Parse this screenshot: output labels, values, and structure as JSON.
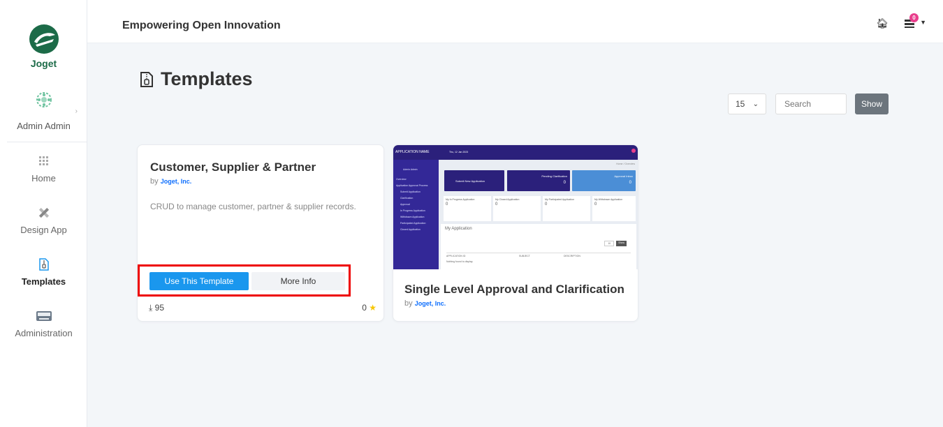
{
  "app": {
    "logo_text": "Joget"
  },
  "profile": {
    "name": "Admin Admin"
  },
  "nav": [
    {
      "label": "Home"
    },
    {
      "label": "Design App"
    },
    {
      "label": "Templates"
    },
    {
      "label": "Administration"
    }
  ],
  "header": {
    "title": "Empowering Open Innovation",
    "notification_count": "0"
  },
  "page": {
    "title": "Templates"
  },
  "filters": {
    "page_size": "15",
    "search_placeholder": "Search",
    "show_label": "Show"
  },
  "templates": [
    {
      "title": "Customer, Supplier & Partner",
      "by_prefix": "by",
      "author": "Joget, Inc.",
      "description": "CRUD to manage customer, partner & supplier records.",
      "use_label": "Use This Template",
      "info_label": "More Info",
      "downloads": "95",
      "rating": "0"
    },
    {
      "title": "Single Level Approval and Clarification",
      "by_prefix": "by",
      "author": "Joget, Inc.",
      "preview": {
        "app_name": "APPLICATION NAME",
        "date": "Thu, 12 Jan 2023",
        "user": "Admin Admin",
        "menu": [
          "Overview",
          "Application Approval Process",
          "Submit Application",
          "Clarification",
          "Approval",
          "In Progress Application",
          "Withdrawn Application",
          "Participated Application",
          "Closed Application"
        ],
        "tiles": [
          "Submit New Application",
          "Pending Clarification",
          "Approval Inbox"
        ],
        "tile_counts": [
          "0",
          "0"
        ],
        "stats": [
          "My In Progress Application",
          "My Closed Application",
          "My Participated Application",
          "My Withdrawn Application"
        ],
        "stat_values": [
          "0",
          "0",
          "0",
          "0"
        ],
        "panel_title": "My Application",
        "columns": [
          "APPLICATION ID",
          "SUBJECT",
          "DESCRIPTION"
        ],
        "empty": "Nothing found to display.",
        "page_size": "10",
        "show": "Show",
        "breadcrumb": "Home / Overview"
      }
    }
  ],
  "colors": {
    "primary": "#1a97ee",
    "highlight": "#e00000",
    "brand": "#1c6b48",
    "preview_dark": "#2b207b"
  }
}
